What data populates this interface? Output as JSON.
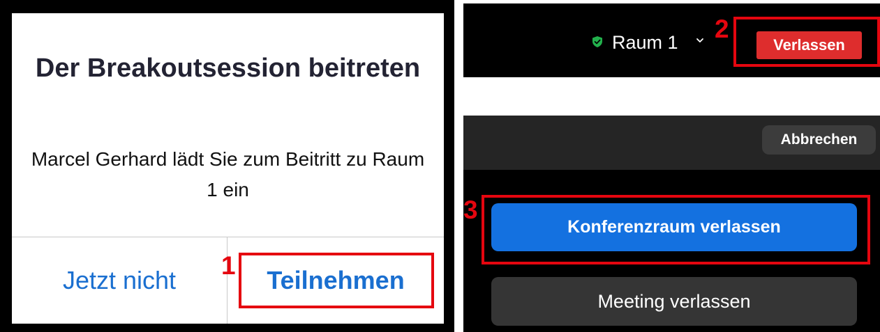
{
  "join_dialog": {
    "title": "Der Breakoutsession beitreten",
    "message": "Marcel Gerhard lädt Sie zum Beitritt zu Raum 1 ein",
    "not_now_label": "Jetzt nicht",
    "join_label": "Teilnehmen"
  },
  "top_bar": {
    "room_name": "Raum 1",
    "leave_label": "Verlassen"
  },
  "leave_menu": {
    "cancel_label": "Abbrechen",
    "leave_room_label": "Konferenzraum verlassen",
    "leave_meeting_label": "Meeting verlassen"
  },
  "annotations": {
    "step_1": "1",
    "step_2": "2",
    "step_3": "3"
  },
  "colors": {
    "highlight": "#e5060f",
    "link_blue": "#1a6fd0",
    "leave_red": "#de2d2d",
    "primary_blue": "#1471e0",
    "shield_green": "#22b14c"
  },
  "icons": {
    "room_status": "shield-check-icon",
    "room_dropdown": "chevron-down-icon"
  }
}
